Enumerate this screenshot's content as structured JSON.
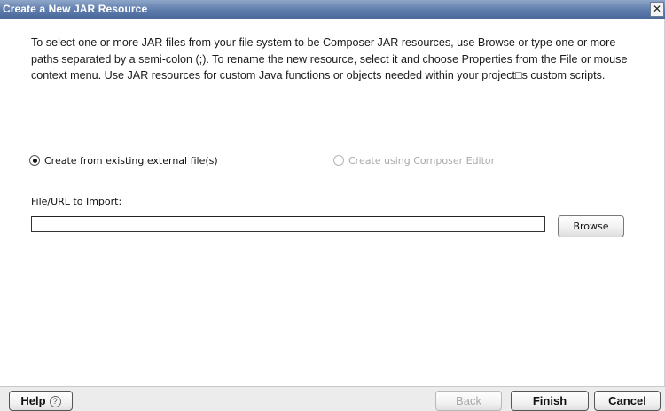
{
  "window": {
    "title": "Create a New JAR Resource",
    "close_glyph": "✕"
  },
  "description": "To select one or more JAR files from your file system to be Composer JAR  resources, use Browse or type one or more paths separated by a semi-colon (;).  To rename the new resource, select it and choose Properties from the File or mouse context menu. Use JAR resources for custom Java functions or objects needed within your project□s custom scripts.",
  "options": {
    "existing": {
      "label": "Create from existing external file(s)",
      "selected": true,
      "enabled": true
    },
    "editor": {
      "label": "Create using Composer Editor",
      "selected": false,
      "enabled": false
    }
  },
  "import_field": {
    "label": "File/URL to Import:",
    "value": "",
    "placeholder": ""
  },
  "buttons": {
    "browse": "Browse",
    "help": "Help",
    "help_icon_glyph": "?",
    "back": "Back",
    "finish": "Finish",
    "cancel": "Cancel"
  },
  "icons": {
    "close": "close-icon",
    "help": "help-circle-icon"
  }
}
